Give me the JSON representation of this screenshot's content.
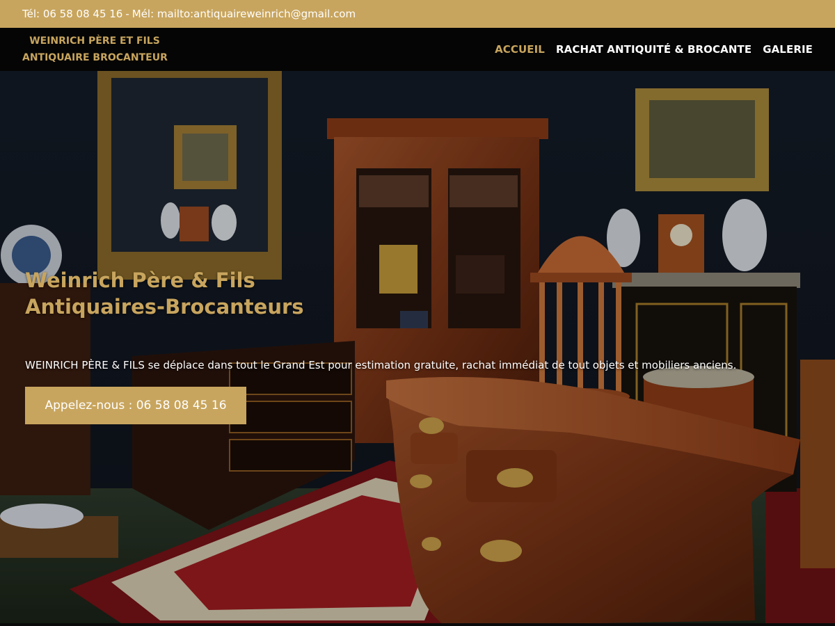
{
  "topbar": {
    "phone": "Tél: 06 58 08 45 16",
    "separator": "-",
    "email": "Mél: mailto:antiquaireweinrich@gmail.com"
  },
  "brand": {
    "line1": "WEINRICH PÈRE ET FILS",
    "line2": "ANTIQUAIRE BROCANTEUR"
  },
  "nav": {
    "items": [
      {
        "label": "ACCUEIL",
        "active": true
      },
      {
        "label": "RACHAT ANTIQUITÉ & BROCANTE",
        "active": false
      },
      {
        "label": "GALERIE",
        "active": false
      }
    ]
  },
  "hero": {
    "title_line1": "Weinrich Père & Fils",
    "title_line2": "Antiquaires-Brocanteurs",
    "text": "WEINRICH PÈRE & FILS se déplace dans tout le Grand Est pour estimation gratuite, rachat immédiat de tout objets et mobiliers anciens.",
    "cta_label": "Appelez-nous : 06 58 08 45 16",
    "background_image": "antique-furniture-showroom"
  },
  "colors": {
    "accent": "#c8a55e",
    "nav_bg": "#050505",
    "text_light": "#ffffff"
  }
}
